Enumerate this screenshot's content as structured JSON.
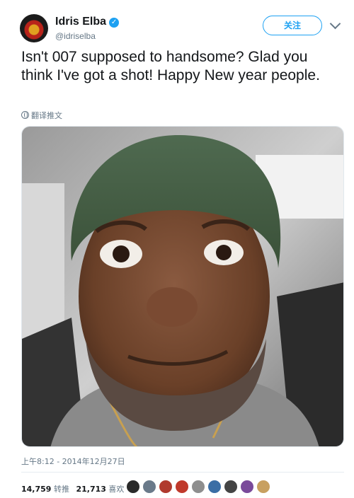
{
  "user": {
    "display_name": "Idris Elba",
    "handle": "@idriselba"
  },
  "actions": {
    "follow_label": "关注"
  },
  "tweet": {
    "text": "Isn't 007 supposed to handsome? Glad you think I've got a shot!  Happy New year people.",
    "translate_label": "翻译推文",
    "timestamp": "上午8:12 - 2014年12月27日"
  },
  "stats": {
    "retweets_count": "14,759",
    "retweets_label": "转推",
    "likes_count": "21,713",
    "likes_label": "喜欢"
  },
  "likers": [
    {
      "name": "liker-avatar-1",
      "color": "#2a2a2a"
    },
    {
      "name": "liker-avatar-2",
      "color": "#6a7a8a"
    },
    {
      "name": "liker-avatar-3",
      "color": "#b03a2e"
    },
    {
      "name": "liker-avatar-4",
      "color": "#c0392b"
    },
    {
      "name": "liker-avatar-5",
      "color": "#8e8e8e"
    },
    {
      "name": "liker-avatar-6",
      "color": "#3b6ea5"
    },
    {
      "name": "liker-avatar-7",
      "color": "#444444"
    },
    {
      "name": "liker-avatar-8",
      "color": "#7a4a9a"
    },
    {
      "name": "liker-avatar-9",
      "color": "#c8a060"
    }
  ],
  "icons": {
    "verified": "verified-badge-icon",
    "more": "chevron-down-icon",
    "translate": "globe-icon"
  },
  "colors": {
    "accent": "#1da1f2",
    "secondary_text": "#657786",
    "primary_text": "#14171a"
  }
}
